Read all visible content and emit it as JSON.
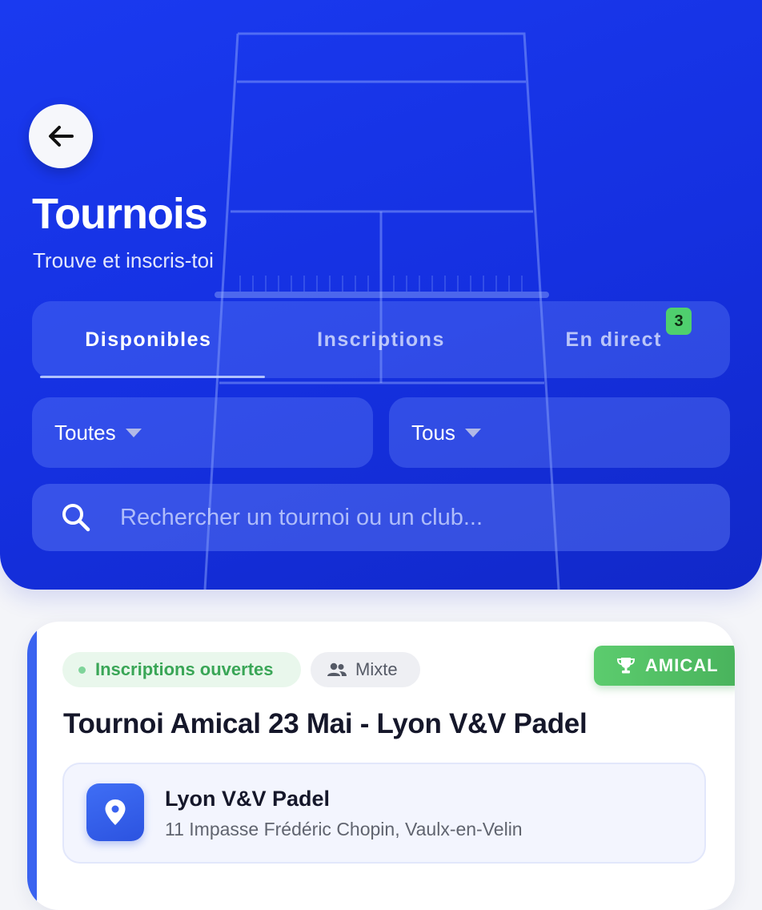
{
  "header": {
    "title": "Tournois",
    "subtitle": "Trouve et inscris-toi"
  },
  "tabs": [
    {
      "label": "Disponibles",
      "active": true
    },
    {
      "label": "Inscriptions",
      "active": false
    },
    {
      "label": "En direct",
      "active": false,
      "badge": "3"
    }
  ],
  "filters": {
    "first": {
      "value": "Toutes"
    },
    "second": {
      "value": "Tous"
    }
  },
  "search": {
    "placeholder": "Rechercher un tournoi ou un club..."
  },
  "tournament_card": {
    "status": "Inscriptions ouvertes",
    "category": "Mixte",
    "type_badge": "AMICAL",
    "title": "Tournoi Amical 23 Mai - Lyon V&V Padel",
    "venue": {
      "name": "Lyon V&V Padel",
      "address": "11 Impasse Frédéric Chopin, Vaulx-en-Velin"
    }
  },
  "colors": {
    "hero": "#1a3af0",
    "badge_green": "#4fcf6e",
    "status_green": "#3aa657",
    "accent_blue": "#3a63f0"
  },
  "icons": {
    "back": "arrow-left-icon",
    "search": "search-icon",
    "category": "people-icon",
    "type": "trophy-icon",
    "venue": "location-pin-icon"
  }
}
